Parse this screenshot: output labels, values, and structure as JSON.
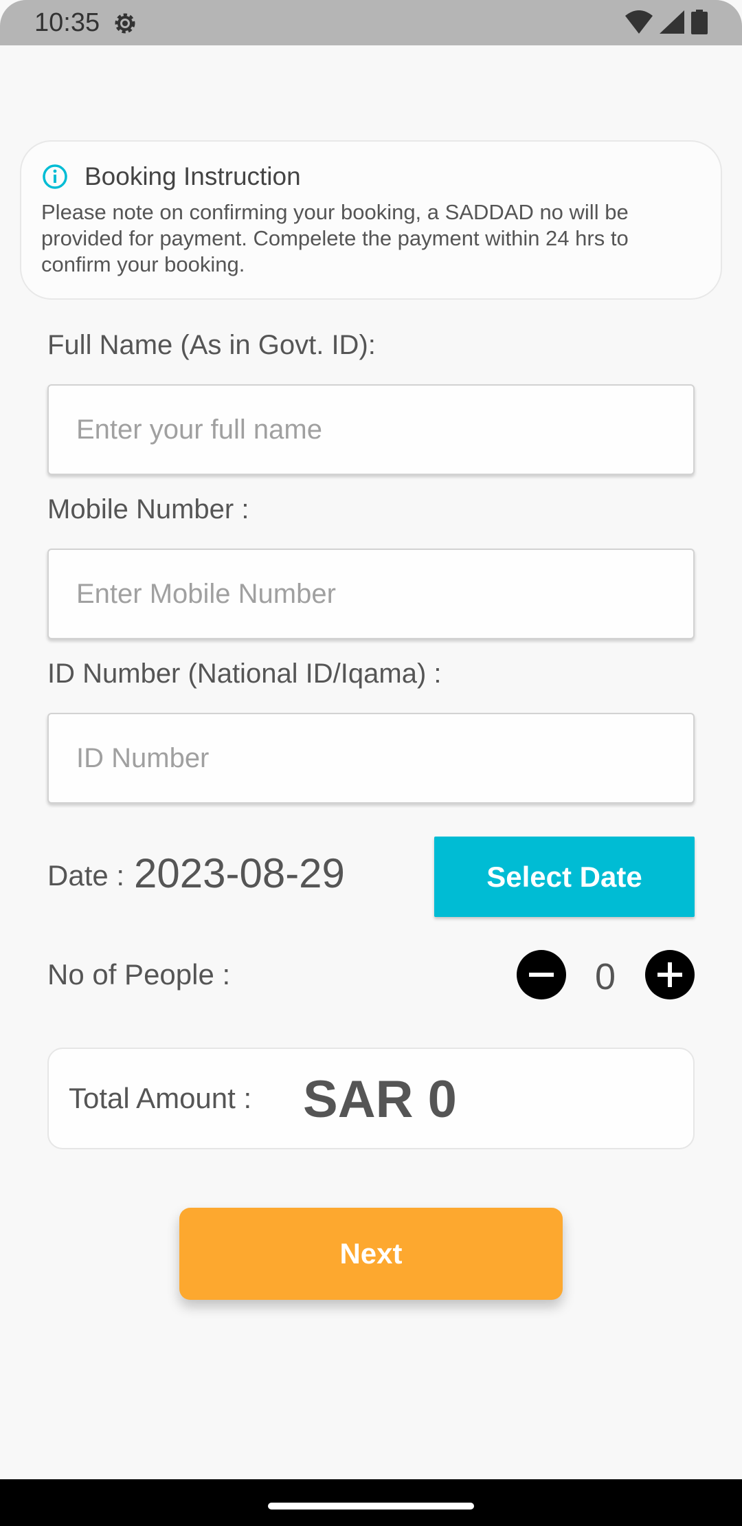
{
  "status_bar": {
    "time": "10:35",
    "icons": [
      "settings-gear-icon",
      "wifi-icon",
      "signal-icon",
      "battery-icon"
    ]
  },
  "instruction": {
    "icon": "info-icon",
    "title": "Booking Instruction",
    "body": "Please note on confirming your booking, a SADDAD no will be provided for payment. Compelete the payment within 24 hrs to confirm your booking."
  },
  "form": {
    "full_name": {
      "label": "Full Name (As in Govt. ID):",
      "value": "",
      "placeholder": "Enter your full name"
    },
    "mobile": {
      "label": "Mobile Number :",
      "value": "",
      "placeholder": "Enter Mobile Number"
    },
    "id_number": {
      "label": "ID Number (National ID/Iqama) :",
      "value": "",
      "placeholder": "ID Number"
    },
    "date": {
      "label": "Date :",
      "value": "2023-08-29",
      "button_label": "Select Date"
    },
    "people": {
      "label": "No of People :",
      "count": "0",
      "decrement_icon": "minus-circle-icon",
      "increment_icon": "plus-circle-icon"
    }
  },
  "total": {
    "label": "Total Amount :",
    "value": "SAR 0"
  },
  "actions": {
    "next_label": "Next"
  },
  "colors": {
    "accent_cyan": "#00bcd4",
    "next_orange": "#fda82f",
    "background": "#f8f8f8",
    "status_bar": "#b5b5b5"
  }
}
